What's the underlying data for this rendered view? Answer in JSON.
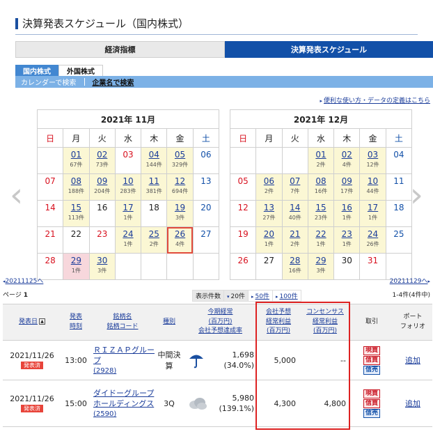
{
  "page_title": "決算発表スケジュール（国内株式）",
  "top_tabs": [
    "経済指標",
    "決算発表スケジュール"
  ],
  "sub_tabs": [
    "国内株式",
    "外国株式"
  ],
  "search_modes": [
    "カレンダーで検索",
    "企業名で検索"
  ],
  "help_link": "便利な使い方・データの定義はこちら",
  "weekdays": [
    "日",
    "月",
    "火",
    "水",
    "木",
    "金",
    "土"
  ],
  "calendars": [
    {
      "title": "2021年 11月",
      "weeks": [
        [
          {
            "d": ""
          },
          {
            "d": "01",
            "c": "67件"
          },
          {
            "d": "02",
            "c": "73件"
          },
          {
            "d": "03",
            "c": ""
          },
          {
            "d": "04",
            "c": "144件"
          },
          {
            "d": "05",
            "c": "329件"
          },
          {
            "d": "06",
            "c": ""
          }
        ],
        [
          {
            "d": "07",
            "c": ""
          },
          {
            "d": "08",
            "c": "188件"
          },
          {
            "d": "09",
            "c": "204件"
          },
          {
            "d": "10",
            "c": "283件"
          },
          {
            "d": "11",
            "c": "381件"
          },
          {
            "d": "12",
            "c": "694件"
          },
          {
            "d": "13",
            "c": ""
          }
        ],
        [
          {
            "d": "14",
            "c": ""
          },
          {
            "d": "15",
            "c": "113件"
          },
          {
            "d": "16",
            "c": ""
          },
          {
            "d": "17",
            "c": "1件"
          },
          {
            "d": "18",
            "c": ""
          },
          {
            "d": "19",
            "c": "3件"
          },
          {
            "d": "20",
            "c": ""
          }
        ],
        [
          {
            "d": "21",
            "c": ""
          },
          {
            "d": "22",
            "c": ""
          },
          {
            "d": "23",
            "c": ""
          },
          {
            "d": "24",
            "c": "1件"
          },
          {
            "d": "25",
            "c": "2件"
          },
          {
            "d": "26",
            "c": "4件"
          },
          {
            "d": "27",
            "c": ""
          }
        ],
        [
          {
            "d": "28",
            "c": ""
          },
          {
            "d": "29",
            "c": "1件"
          },
          {
            "d": "30",
            "c": "3件"
          },
          {
            "d": ""
          },
          {
            "d": ""
          },
          {
            "d": ""
          },
          {
            "d": ""
          }
        ]
      ]
    },
    {
      "title": "2021年 12月",
      "weeks": [
        [
          {
            "d": ""
          },
          {
            "d": ""
          },
          {
            "d": ""
          },
          {
            "d": "01",
            "c": "2件"
          },
          {
            "d": "02",
            "c": "4件"
          },
          {
            "d": "03",
            "c": "12件"
          },
          {
            "d": "04",
            "c": ""
          }
        ],
        [
          {
            "d": "05",
            "c": ""
          },
          {
            "d": "06",
            "c": "2件"
          },
          {
            "d": "07",
            "c": "7件"
          },
          {
            "d": "08",
            "c": "16件"
          },
          {
            "d": "09",
            "c": "17件"
          },
          {
            "d": "10",
            "c": "44件"
          },
          {
            "d": "11",
            "c": ""
          }
        ],
        [
          {
            "d": "12",
            "c": ""
          },
          {
            "d": "13",
            "c": "27件"
          },
          {
            "d": "14",
            "c": "40件"
          },
          {
            "d": "15",
            "c": "23件"
          },
          {
            "d": "16",
            "c": "1件"
          },
          {
            "d": "17",
            "c": "1件"
          },
          {
            "d": "18",
            "c": ""
          }
        ],
        [
          {
            "d": "19",
            "c": ""
          },
          {
            "d": "20",
            "c": "1件"
          },
          {
            "d": "21",
            "c": "2件"
          },
          {
            "d": "22",
            "c": "1件"
          },
          {
            "d": "23",
            "c": "1件"
          },
          {
            "d": "24",
            "c": "26件"
          },
          {
            "d": "25",
            "c": ""
          }
        ],
        [
          {
            "d": "26",
            "c": ""
          },
          {
            "d": "27",
            "c": ""
          },
          {
            "d": "28",
            "c": "16件"
          },
          {
            "d": "29",
            "c": "3件"
          },
          {
            "d": "30",
            "c": ""
          },
          {
            "d": "31",
            "c": ""
          },
          {
            "d": ""
          }
        ]
      ]
    }
  ],
  "prev_link": "20211125へ",
  "next_link": "20211129へ",
  "page_label": "ページ",
  "page_number": "1",
  "per_page_label": "表示件数",
  "per_page_options": [
    "20件",
    "50件",
    "100件"
  ],
  "result_count": "1-4件(4件中)",
  "columns": {
    "date": "発表日",
    "time": [
      "発表",
      "時刻"
    ],
    "name": [
      "銘柄名",
      "銘柄コード"
    ],
    "type": "種別",
    "profit": [
      "今期経常",
      "(百万円)",
      "会社予想達成率"
    ],
    "company_forecast": [
      "会社予想",
      "経常利益",
      "(百万円)"
    ],
    "consensus": [
      "コンセンサス",
      "経常利益",
      "(百万円)"
    ],
    "trade": "取引",
    "portfolio": [
      "ポート",
      "フォリオ"
    ]
  },
  "rows": [
    {
      "date": "2021/11/26",
      "status": "発表済",
      "time": "13:00",
      "name": "ＲＩＺＡＰグループ",
      "code": "(2928)",
      "type": "中間決算",
      "weather": "umbrella-icon",
      "profit": "1,698",
      "rate": "(34.0%)",
      "company_forecast": "5,000",
      "consensus": "--",
      "trade": [
        "現買",
        "信買",
        "信売"
      ],
      "portfolio": "追加"
    },
    {
      "date": "2021/11/26",
      "status": "発表済",
      "time": "15:00",
      "name": "ダイドーグループホールディングス",
      "code": "(2590)",
      "type": "3Q",
      "weather": "cloud-icon",
      "profit": "5,980",
      "rate": "(139.1%)",
      "company_forecast": "4,300",
      "consensus": "4,800",
      "trade": [
        "現買",
        "信買",
        "信売"
      ],
      "portfolio": "追加"
    }
  ],
  "colors": {
    "accent": "#1250a8",
    "highlight": "#e14a3b",
    "count_bg": "#fbf7d4",
    "red": "#d8111f"
  }
}
